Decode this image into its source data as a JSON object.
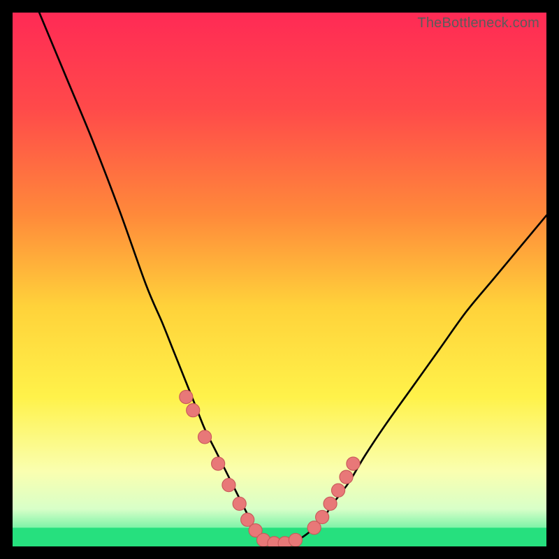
{
  "watermark": {
    "text": "TheBottleneck.com"
  },
  "colors": {
    "frame": "#000000",
    "curve_stroke": "#000000",
    "dot_fill": "#e87878",
    "dot_stroke": "#c95a5a",
    "green_band": "#26e07e",
    "gradient_stops": [
      {
        "offset": 0.0,
        "color": "#ff2a55"
      },
      {
        "offset": 0.18,
        "color": "#ff4a4a"
      },
      {
        "offset": 0.38,
        "color": "#ff8a3a"
      },
      {
        "offset": 0.55,
        "color": "#ffd23a"
      },
      {
        "offset": 0.72,
        "color": "#fff24a"
      },
      {
        "offset": 0.86,
        "color": "#faffb0"
      },
      {
        "offset": 0.93,
        "color": "#d8ffc8"
      },
      {
        "offset": 0.965,
        "color": "#7ef3a8"
      },
      {
        "offset": 1.0,
        "color": "#26e07e"
      }
    ]
  },
  "chart_data": {
    "type": "line",
    "title": "",
    "xlabel": "",
    "ylabel": "",
    "xlim": [
      0,
      100
    ],
    "ylim": [
      0,
      100
    ],
    "grid": false,
    "legend": false,
    "series": [
      {
        "name": "bottleneck-curve",
        "x": [
          5,
          10,
          15,
          20,
          25,
          28,
          30,
          32,
          34,
          36,
          38,
          40,
          42,
          44,
          45,
          46,
          47,
          48,
          50,
          53,
          56,
          58,
          60,
          63,
          66,
          70,
          75,
          80,
          85,
          90,
          95,
          100
        ],
        "y": [
          100,
          88,
          76,
          63,
          49,
          42,
          37,
          32,
          27,
          22,
          18,
          14,
          10,
          6,
          4,
          2,
          1,
          0.5,
          0.5,
          1,
          3,
          5,
          8,
          12,
          17,
          23,
          30,
          37,
          44,
          50,
          56,
          62
        ]
      }
    ],
    "markers": {
      "name": "highlighted-points",
      "comment": "salmon scatter dots near the valley on both branches",
      "x": [
        32.5,
        33.8,
        36.0,
        38.5,
        40.5,
        42.5,
        44.0,
        45.5,
        47.0,
        49.0,
        51.0,
        53.0,
        56.5,
        58.0,
        59.5,
        61.0,
        62.5,
        63.8
      ],
      "y": [
        28.0,
        25.5,
        20.5,
        15.5,
        11.5,
        8.0,
        5.0,
        3.0,
        1.2,
        0.6,
        0.6,
        1.2,
        3.5,
        5.5,
        8.0,
        10.5,
        13.0,
        15.5
      ]
    },
    "green_band_y": [
      0,
      3.5
    ]
  }
}
